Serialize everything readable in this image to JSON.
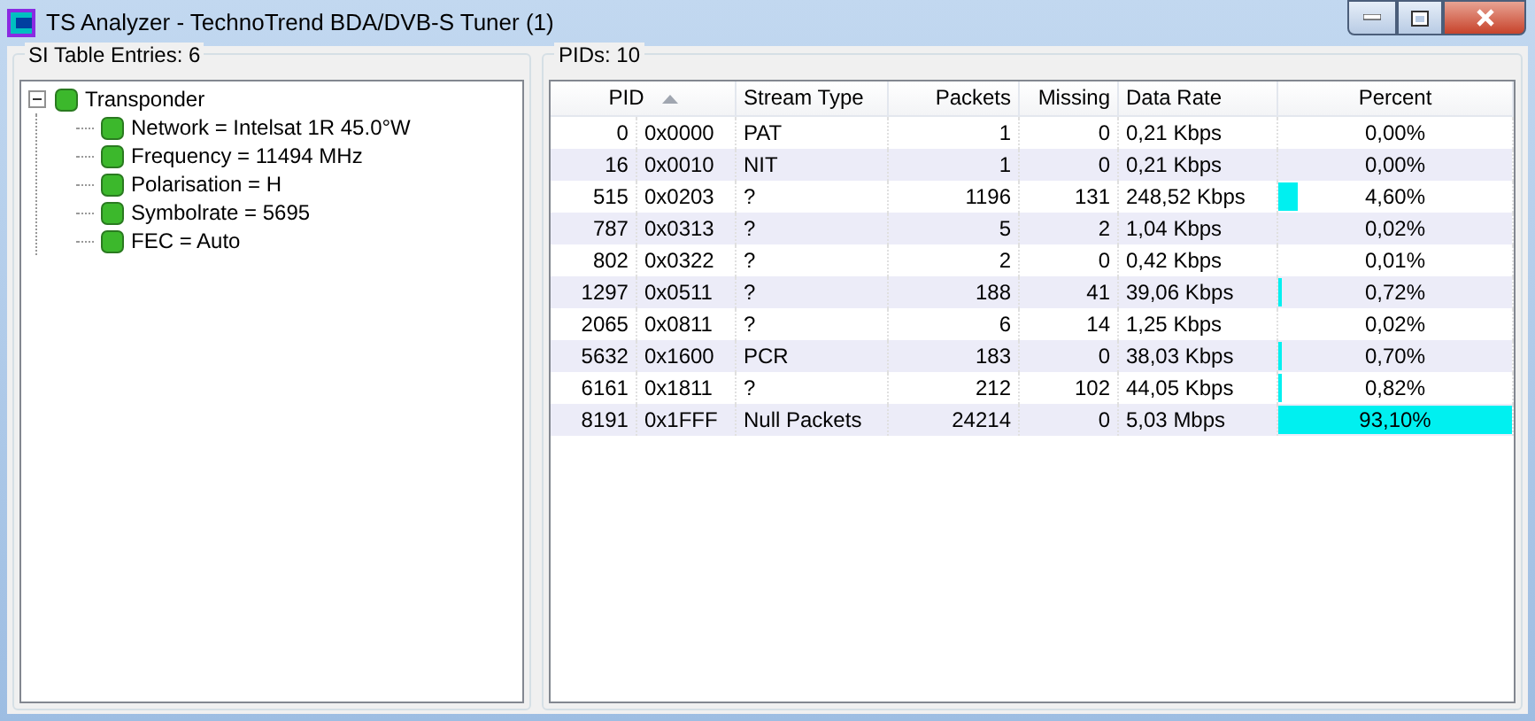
{
  "window": {
    "title": "TS Analyzer - TechnoTrend BDA/DVB-S Tuner (1)"
  },
  "si_panel": {
    "title": "SI Table Entries: 6",
    "tree": [
      {
        "label": "Transponder",
        "expanded": true,
        "children": [
          {
            "label": "Network = Intelsat 1R 45.0°W"
          },
          {
            "label": "Frequency = 11494 MHz"
          },
          {
            "label": "Polarisation = H"
          },
          {
            "label": "Symbolrate = 5695"
          },
          {
            "label": "FEC = Auto"
          }
        ]
      }
    ]
  },
  "pid_panel": {
    "title": "PIDs: 10",
    "table": {
      "columns": [
        {
          "label": "PID",
          "sorted": true
        },
        {
          "label": "Stream Type",
          "sorted": false
        },
        {
          "label": "Packets",
          "sorted": false
        },
        {
          "label": "Missing",
          "sorted": false
        },
        {
          "label": "Data Rate",
          "sorted": false
        },
        {
          "label": "Percent",
          "sorted": false
        }
      ],
      "rows": [
        {
          "pid": "0",
          "hex": "0x0000",
          "stream_type": "PAT",
          "packets": "1",
          "missing": "0",
          "data_rate": "0,21 Kbps",
          "percent": "0,00%",
          "level": 0
        },
        {
          "pid": "16",
          "hex": "0x0010",
          "stream_type": "NIT",
          "packets": "1",
          "missing": "0",
          "data_rate": "0,21 Kbps",
          "percent": "0,00%",
          "level": 0
        },
        {
          "pid": "515",
          "hex": "0x0203",
          "stream_type": "?",
          "packets": "1196",
          "missing": "131",
          "data_rate": "248,52 Kbps",
          "percent": "4,60%",
          "level": 0.08
        },
        {
          "pid": "787",
          "hex": "0x0313",
          "stream_type": "?",
          "packets": "5",
          "missing": "2",
          "data_rate": "1,04 Kbps",
          "percent": "0,02%",
          "level": 0
        },
        {
          "pid": "802",
          "hex": "0x0322",
          "stream_type": "?",
          "packets": "2",
          "missing": "0",
          "data_rate": "0,42 Kbps",
          "percent": "0,01%",
          "level": 0
        },
        {
          "pid": "1297",
          "hex": "0x0511",
          "stream_type": "?",
          "packets": "188",
          "missing": "41",
          "data_rate": "39,06 Kbps",
          "percent": "0,72%",
          "level": 0.015
        },
        {
          "pid": "2065",
          "hex": "0x0811",
          "stream_type": "?",
          "packets": "6",
          "missing": "14",
          "data_rate": "1,25 Kbps",
          "percent": "0,02%",
          "level": 0
        },
        {
          "pid": "5632",
          "hex": "0x1600",
          "stream_type": "PCR",
          "packets": "183",
          "missing": "0",
          "data_rate": "38,03 Kbps",
          "percent": "0,70%",
          "level": 0.015
        },
        {
          "pid": "6161",
          "hex": "0x1811",
          "stream_type": "?",
          "packets": "212",
          "missing": "102",
          "data_rate": "44,05 Kbps",
          "percent": "0,82%",
          "level": 0.015
        },
        {
          "pid": "8191",
          "hex": "0x1FFF",
          "stream_type": "Null Packets",
          "packets": "24214",
          "missing": "0",
          "data_rate": "5,03 Mbps",
          "percent": "93,10%",
          "level": 1
        }
      ]
    }
  }
}
